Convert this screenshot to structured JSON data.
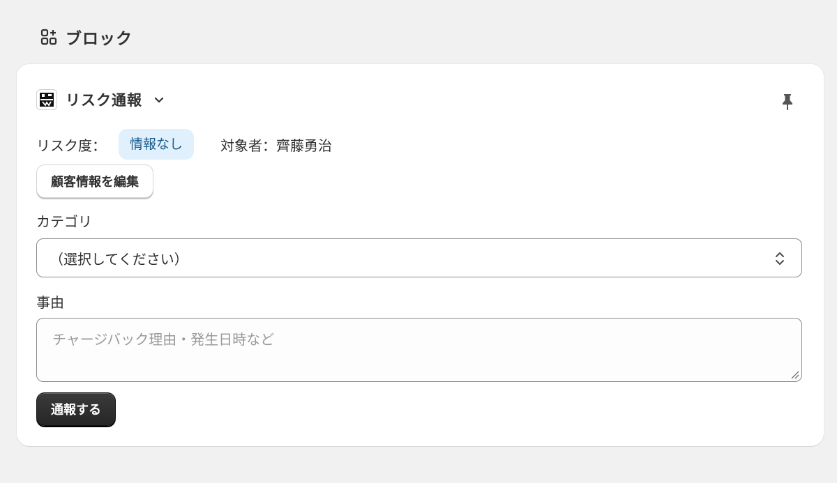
{
  "header": {
    "title": "ブロック",
    "icon": "blocks-icon"
  },
  "block": {
    "app_name": "リスク通報",
    "app_icon": "app-logo-icon",
    "risk_label": "リスク度：",
    "risk_badge": "情報なし",
    "target": "対象者：齊藤勇治",
    "edit_button_label": "顧客情報を編集",
    "category_label": "カテゴリ",
    "category_selected": "（選択してください）",
    "reason_label": "事由",
    "reason_placeholder": "チャージバック理由・発生日時など",
    "reason_value": "",
    "submit_label": "通報する"
  },
  "colors": {
    "background": "#f1f1f1",
    "card": "#ffffff",
    "badge_bg": "#e0f0fd",
    "badge_text": "#1a5a8a",
    "primary_button": "#303030"
  }
}
